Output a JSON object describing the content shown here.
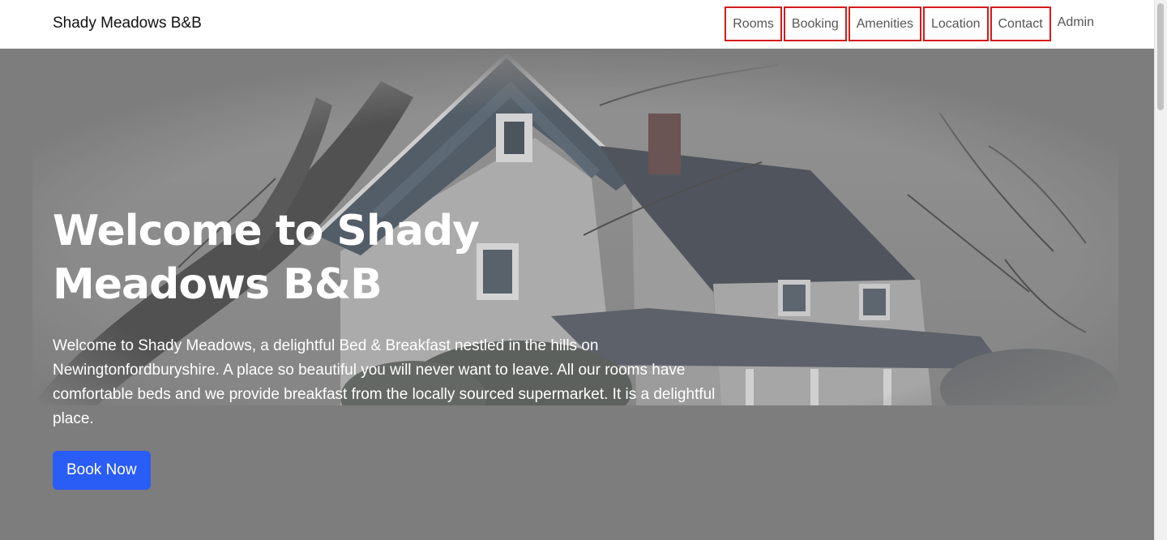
{
  "navbar": {
    "brand": "Shady Meadows B&B",
    "links": [
      {
        "label": "Rooms"
      },
      {
        "label": "Booking"
      },
      {
        "label": "Amenities"
      },
      {
        "label": "Location"
      },
      {
        "label": "Contact"
      },
      {
        "label": "Admin"
      }
    ]
  },
  "hero": {
    "title": "Welcome to Shady Meadows B&B",
    "description": "Welcome to Shady Meadows, a delightful Bed & Breakfast nestled in the hills on Newingtonfordburyshire. A place so beautiful you will never want to leave. All our rooms have comfortable beds and we provide breakfast from the locally sourced supermarket. It is a delightful place.",
    "button_label": "Book Now"
  },
  "colors": {
    "accent": "#2a5cf6",
    "nav_highlight_border": "#d41b1b",
    "hero_background": "#808080",
    "nav_background": "#ffffff"
  }
}
